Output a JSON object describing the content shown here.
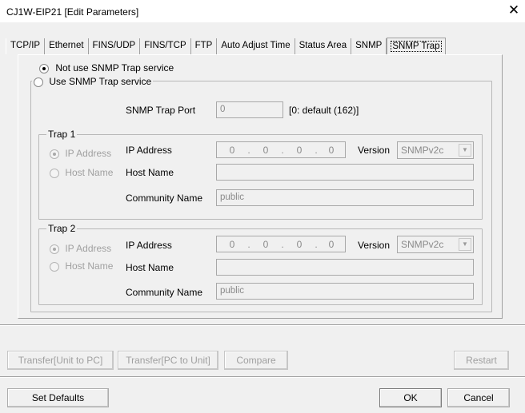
{
  "window": {
    "title": "CJ1W-EIP21 [Edit Parameters]",
    "close_glyph": "✕"
  },
  "tabs": [
    "TCP/IP",
    "Ethernet",
    "FINS/UDP",
    "FINS/TCP",
    "FTP",
    "Auto Adjust Time",
    "Status Area",
    "SNMP",
    "SNMP Trap"
  ],
  "active_tab": "SNMP Trap",
  "service": {
    "not_use_label": "Not use SNMP Trap service",
    "use_label": "Use SNMP Trap service",
    "selected": "not_use"
  },
  "port": {
    "label": "SNMP Trap Port",
    "value": "0",
    "hint": "[0: default (162)]"
  },
  "traps": [
    {
      "title": "Trap 1",
      "ip_option": "IP Address",
      "host_option": "Host Name",
      "ip_label": "IP Address",
      "ip_octets": [
        "0",
        "0",
        "0",
        "0"
      ],
      "ip_dot": ".",
      "version_label": "Version",
      "version_value": "SNMPv2c",
      "host_label": "Host Name",
      "host_value": "",
      "community_label": "Community Name",
      "community_value": "public"
    },
    {
      "title": "Trap 2",
      "ip_option": "IP Address",
      "host_option": "Host Name",
      "ip_label": "IP Address",
      "ip_octets": [
        "0",
        "0",
        "0",
        "0"
      ],
      "ip_dot": ".",
      "version_label": "Version",
      "version_value": "SNMPv2c",
      "host_label": "Host Name",
      "host_value": "",
      "community_label": "Community Name",
      "community_value": "public"
    }
  ],
  "transfer_buttons": {
    "unit_to_pc": "Transfer[Unit to PC]",
    "pc_to_unit": "Transfer[PC to Unit]",
    "compare": "Compare",
    "restart": "Restart"
  },
  "bottom_buttons": {
    "set_defaults": "Set Defaults",
    "ok": "OK",
    "cancel": "Cancel"
  },
  "colors": {
    "window_bg": "#f0f0f0",
    "title_bg": "#ffffff",
    "disabled_text": "#a0a0a0"
  },
  "icons": {
    "close": "close-icon",
    "dropdown": "chevron-down-icon"
  }
}
